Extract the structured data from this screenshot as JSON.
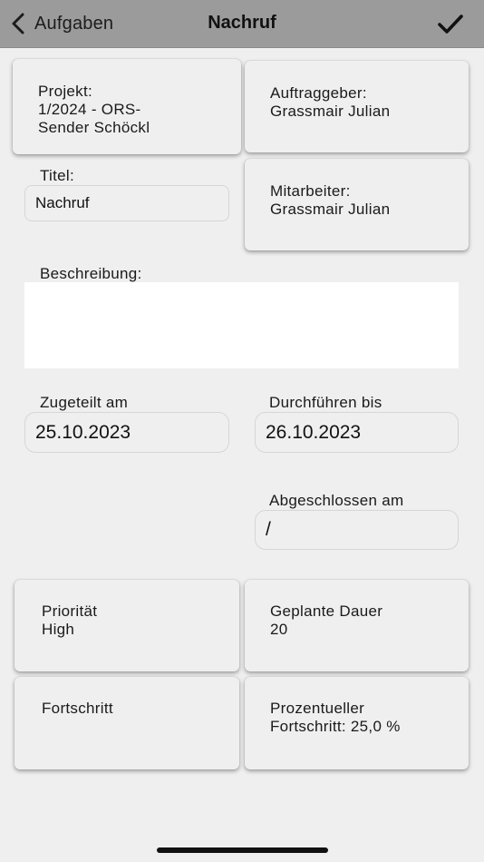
{
  "nav": {
    "back_label": "Aufgaben",
    "title": "Nachruf",
    "done_icon": "checkmark-icon"
  },
  "cards": {
    "projekt": {
      "label": "Projekt:",
      "value_line1": "1/2024 - ORS-",
      "value_line2": "Sender Schöckl"
    },
    "auftraggeber": {
      "label": "Auftraggeber:",
      "value": "Grassmair Julian"
    },
    "mitarbeiter": {
      "label": "Mitarbeiter:",
      "value": "Grassmair Julian"
    },
    "prioritaet": {
      "label": "Priorität",
      "value": "High"
    },
    "geplante_dauer": {
      "label": "Geplante Dauer",
      "value": "20"
    },
    "fortschritt": {
      "label": "Fortschritt"
    },
    "prozentueller": {
      "label": "Prozentueller",
      "value": "Fortschritt: 25,0 %"
    }
  },
  "form": {
    "titel_label": "Titel:",
    "titel_value": "Nachruf",
    "beschreibung_label": "Beschreibung:",
    "beschreibung_value": "",
    "zugeteilt_label": "Zugeteilt am",
    "zugeteilt_value": "25.10.2023",
    "durchfuehren_label": "Durchführen bis",
    "durchfuehren_value": "26.10.2023",
    "abgeschlossen_label": "Abgeschlossen am",
    "abgeschlossen_value": "/"
  }
}
